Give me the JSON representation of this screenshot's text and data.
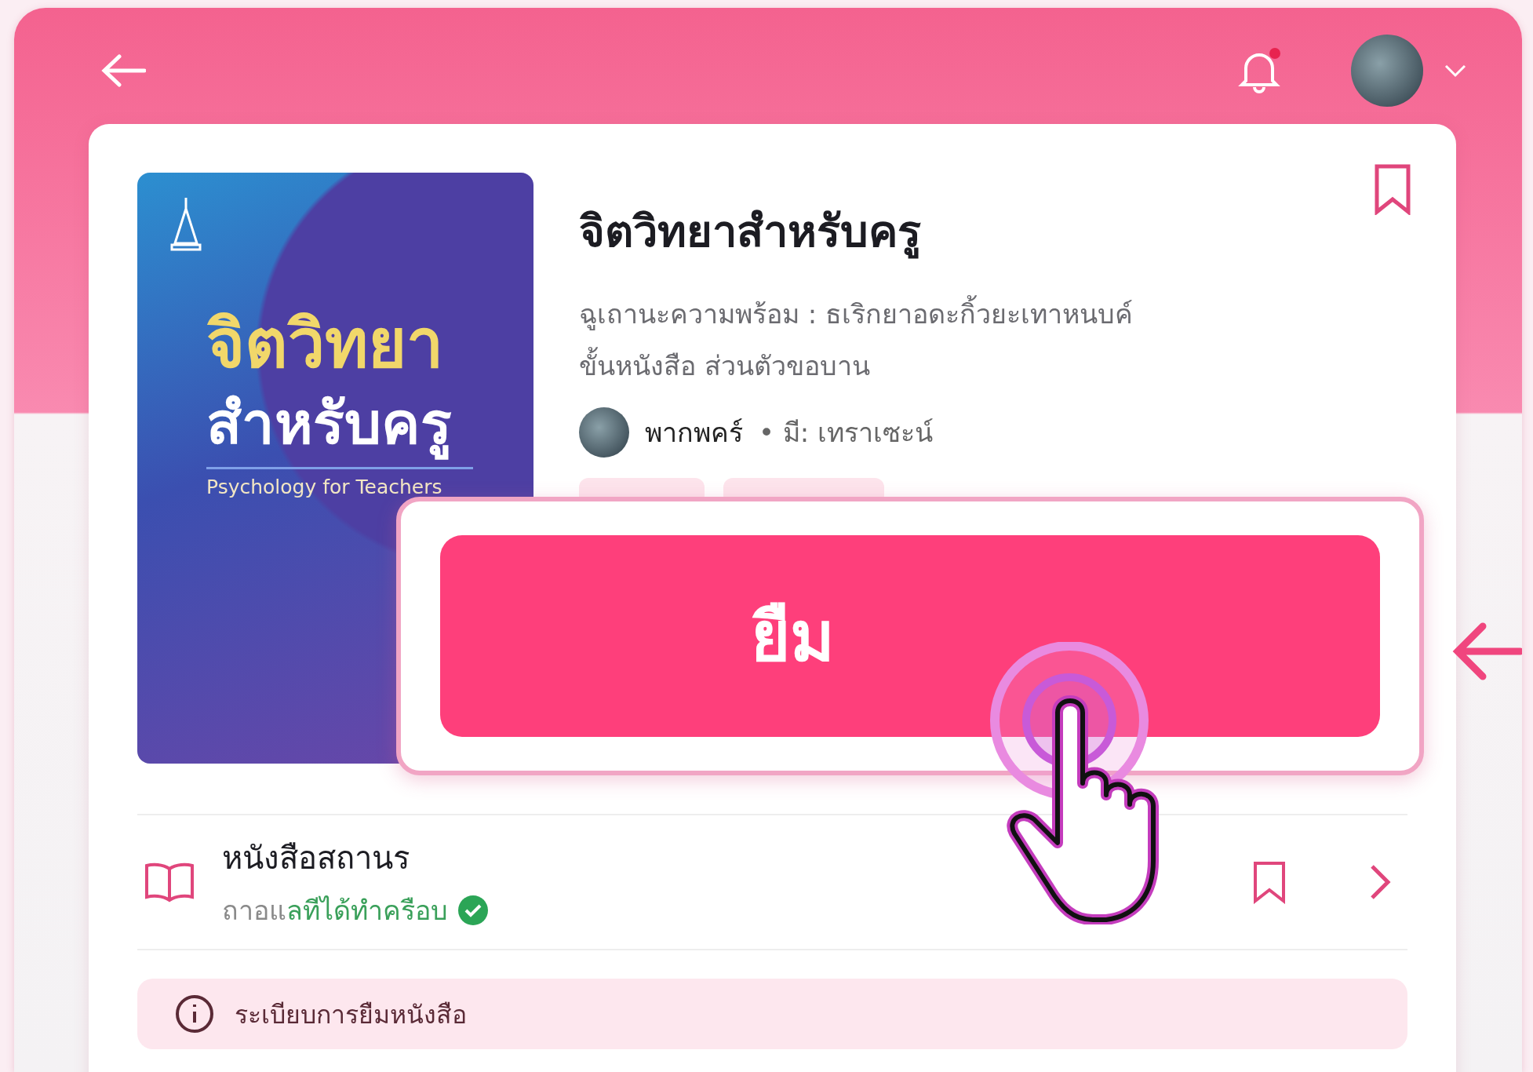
{
  "header": {
    "has_notification": true
  },
  "book": {
    "cover": {
      "title_line_1": "จิตวิทยา",
      "title_line_2": "สำหรับครู",
      "subtitle": "Psychology for Teachers"
    },
    "title": "จิตวิทยาสำหรับครู",
    "description_lines": [
      "ฉูเถานะความพร้อม : ธเริกยาอดะกิ้วยะเทาหนบค์",
      "ขั้นหนังสือ ส่วนตัวขอบาน"
    ],
    "author": "พากพคร์",
    "meta": "• มี: เทราเซะน์",
    "bookmarked": false
  },
  "borrow_button": {
    "label": "ยืม"
  },
  "rows": [
    {
      "title": "หนังสือสถานร",
      "status_muted": "ถาอแ",
      "status_ok": "ลทีได้ทำครือบ",
      "available": true
    }
  ],
  "notice": {
    "text": "ระเบียบการยืมหนังสือ"
  }
}
